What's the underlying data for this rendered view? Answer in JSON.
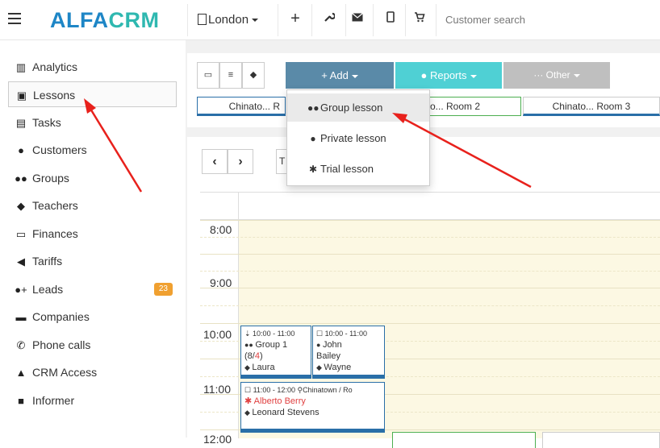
{
  "topbar": {
    "logo_part1": "ALFA",
    "logo_part2": "CRM",
    "branch": "London",
    "search_placeholder": "Customer search"
  },
  "sidebar": {
    "items": [
      {
        "label": "Analytics",
        "icon": "analytics-icon"
      },
      {
        "label": "Lessons",
        "icon": "calendar-icon"
      },
      {
        "label": "Tasks",
        "icon": "tasks-icon"
      },
      {
        "label": "Customers",
        "icon": "user-icon"
      },
      {
        "label": "Groups",
        "icon": "group-icon"
      },
      {
        "label": "Teachers",
        "icon": "graduation-cap-icon"
      },
      {
        "label": "Finances",
        "icon": "money-icon"
      },
      {
        "label": "Tariffs",
        "icon": "tag-icon"
      },
      {
        "label": "Leads",
        "icon": "user-plus-icon",
        "badge": "23"
      },
      {
        "label": "Companies",
        "icon": "briefcase-icon"
      },
      {
        "label": "Phone calls",
        "icon": "phone-icon"
      },
      {
        "label": "CRM Access",
        "icon": "lock-icon"
      },
      {
        "label": "Informer",
        "icon": "book-icon"
      }
    ]
  },
  "toolbar": {
    "add_label": "+ Add",
    "reports_label": "Reports",
    "other_label": "··· Other"
  },
  "rooms": [
    "Chinato... R",
    "o... Room 2",
    "Chinato... Room 3"
  ],
  "add_menu": {
    "items": [
      {
        "label": "Group lesson",
        "icon": "group-icon"
      },
      {
        "label": "Private lesson",
        "icon": "user-icon"
      },
      {
        "label": "Trial lesson",
        "icon": "asterisk-icon"
      }
    ]
  },
  "calendar": {
    "today_fragment": "T",
    "times": [
      "8:00",
      "9:00",
      "10:00",
      "11:00",
      "12:00"
    ],
    "events": [
      {
        "time": "10:00 - 11:00",
        "title": "Group 1",
        "count_prefix": "(8/",
        "count_red": "4",
        "count_suffix": ")",
        "teacher": "Laura"
      },
      {
        "time": "10:00 - 11:00",
        "title": "John",
        "title2": "Bailey",
        "teacher": "Wayne"
      },
      {
        "time": "11:00 - 12:00",
        "location": "Chinatown / Ro",
        "student": "Alberto Berry",
        "teacher": "Leonard Stevens"
      }
    ]
  },
  "colors": {
    "brand_blue": "#1e86c6",
    "brand_teal": "#2fb8b0",
    "add_button": "#5a8aa8",
    "reports_button": "#4fd0d4",
    "other_button": "#bfbfbf",
    "badge": "#f0a030",
    "annotation_arrow": "#e8211c"
  }
}
